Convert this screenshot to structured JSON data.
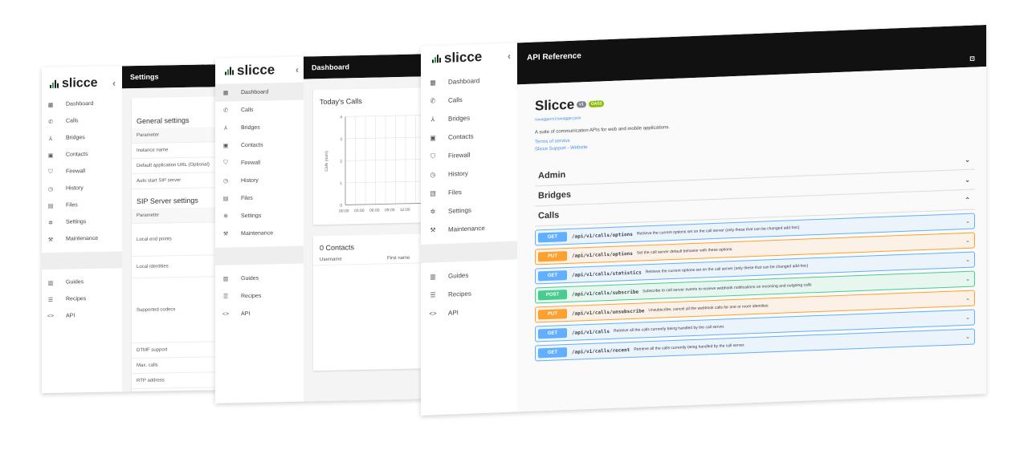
{
  "brand": "slicce",
  "nav": [
    {
      "label": "Dashboard",
      "icon": "dashboard-icon",
      "glyph": "▦"
    },
    {
      "label": "Calls",
      "icon": "phone-icon",
      "glyph": "✆"
    },
    {
      "label": "Bridges",
      "icon": "bridge-icon",
      "glyph": "⅄"
    },
    {
      "label": "Contacts",
      "icon": "contacts-icon",
      "glyph": "▣"
    },
    {
      "label": "Firewall",
      "icon": "shield-icon",
      "glyph": "⛉"
    },
    {
      "label": "History",
      "icon": "history-icon",
      "glyph": "◷"
    },
    {
      "label": "Files",
      "icon": "files-icon",
      "glyph": "▤"
    },
    {
      "label": "Settings",
      "icon": "gear-icon",
      "glyph": "✲"
    },
    {
      "label": "Maintenance",
      "icon": "wrench-icon",
      "glyph": "⚒"
    },
    {
      "label": "Guides",
      "icon": "book-icon",
      "glyph": "▥"
    },
    {
      "label": "Recipes",
      "icon": "recipes-icon",
      "glyph": "☰"
    },
    {
      "label": "API",
      "icon": "code-icon",
      "glyph": "<>"
    }
  ],
  "settings_window": {
    "title": "Settings",
    "general_heading": "General settings",
    "general_rows": [
      "Parameter",
      "Instance name",
      "Default application URL (Optional)",
      "Auto start SIP server"
    ],
    "sip_heading": "SIP Server settings",
    "sip_rows": [
      "Parameter",
      "Local end points",
      "Local identities",
      "Supported codecs",
      "DTMF support",
      "Max. calls",
      "RTP address"
    ]
  },
  "dashboard_window": {
    "title": "Dashboard",
    "calls_card_title": "Today's Calls",
    "contacts_card_title": "0 Contacts",
    "contacts_columns": [
      "Username",
      "First name"
    ]
  },
  "chart_data": {
    "type": "line",
    "title": "Today's Calls",
    "xlabel": "",
    "ylabel": "Calls (num)",
    "x": [
      "00:00",
      "03:00",
      "06:00",
      "09:00",
      "12:00"
    ],
    "yticks": [
      "0",
      "1",
      "2",
      "3",
      "4"
    ],
    "ylim": [
      0,
      4
    ],
    "series": [],
    "grid": true
  },
  "api_window": {
    "title": "API Reference",
    "api_name": "Slicce",
    "version_badge": "v1",
    "spec_badge": "OAS3",
    "spec_link": "/swagger/v1/swagger.json",
    "description": "A suite of communication APIs for web and mobile applications.",
    "links": [
      "Terms of service",
      "Slicce Support - Website"
    ],
    "sections": [
      {
        "name": "Admin",
        "chevron": "⌄"
      },
      {
        "name": "Bridges",
        "chevron": "⌄"
      },
      {
        "name": "Calls",
        "chevron": "⌃"
      }
    ],
    "operations": [
      {
        "method": "GET",
        "path": "/api/v1/calls/options",
        "summary": "Retrieve the current options set on the call server (only these that can be changed add-hoc)",
        "kind": "get"
      },
      {
        "method": "PUT",
        "path": "/api/v1/calls/options",
        "summary": "Set the call server default behavior with these options.",
        "kind": "put"
      },
      {
        "method": "GET",
        "path": "/api/v1/calls/statistics",
        "summary": "Retrieve the current options set on the call server (only these that can be changed add-hoc)",
        "kind": "get"
      },
      {
        "method": "POST",
        "path": "/api/v1/calls/subscribe",
        "summary": "Subscribe to call server events to recieve webhook notifications on incoming and outgoing calls",
        "kind": "post"
      },
      {
        "method": "PUT",
        "path": "/api/v1/calls/unsubscribe",
        "summary": "Unsubscribe, cancel all the webhook calls for one or more identities",
        "kind": "put"
      },
      {
        "method": "GET",
        "path": "/api/v1/calls",
        "summary": "Retrieve all the calls currently being handled by the call server.",
        "kind": "get"
      },
      {
        "method": "GET",
        "path": "/api/v1/calls/recent",
        "summary": "Retrieve all the calls currently being handled by the call server.",
        "kind": "get"
      }
    ]
  }
}
